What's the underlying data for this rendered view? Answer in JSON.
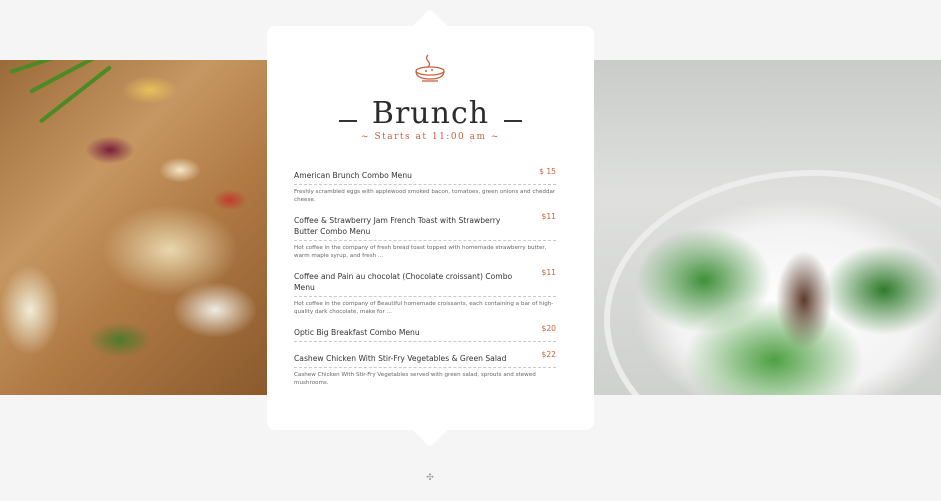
{
  "menu": {
    "title": "Brunch",
    "subtitle": "~ Starts at 11:00 am ~",
    "items": [
      {
        "name": "American Brunch Combo Menu",
        "price": "$ 15",
        "description": "Freshly scrambled eggs with applewood smoked bacon, tomatoes, green onions and cheddar cheese."
      },
      {
        "name": "Coffee & Strawberry Jam French Toast with Strawberry Butter Combo Menu",
        "price": "$11",
        "description": "Hot coffee in the company of fresh bread toast topped with homemade strawberry butter, warm maple syrup, and fresh ..."
      },
      {
        "name": "Coffee and Pain au chocolat (Chocolate croissant) Combo Menu",
        "price": "$11",
        "description": "Hot coffee in the company of Beautiful homemade croissants, each containing a bar of high-quality dark chocolate, make for ..."
      },
      {
        "name": "Optic Big Breakfast Combo Menu",
        "price": "$20",
        "description": ""
      },
      {
        "name": "Cashew Chicken With Stir-Fry Vegetables & Green Salad",
        "price": "$22",
        "description": "Cashew Chicken With Stir-Fry Vegetables served with green salad, sprouts and stewed mushrooms."
      }
    ]
  },
  "icons": {
    "header": "dish-bowl-icon",
    "footer": "decorative-cross-icon"
  },
  "colors": {
    "accent": "#c5633f",
    "text": "#2c2c2c",
    "background": "#f5f5f5",
    "card": "#ffffff"
  }
}
